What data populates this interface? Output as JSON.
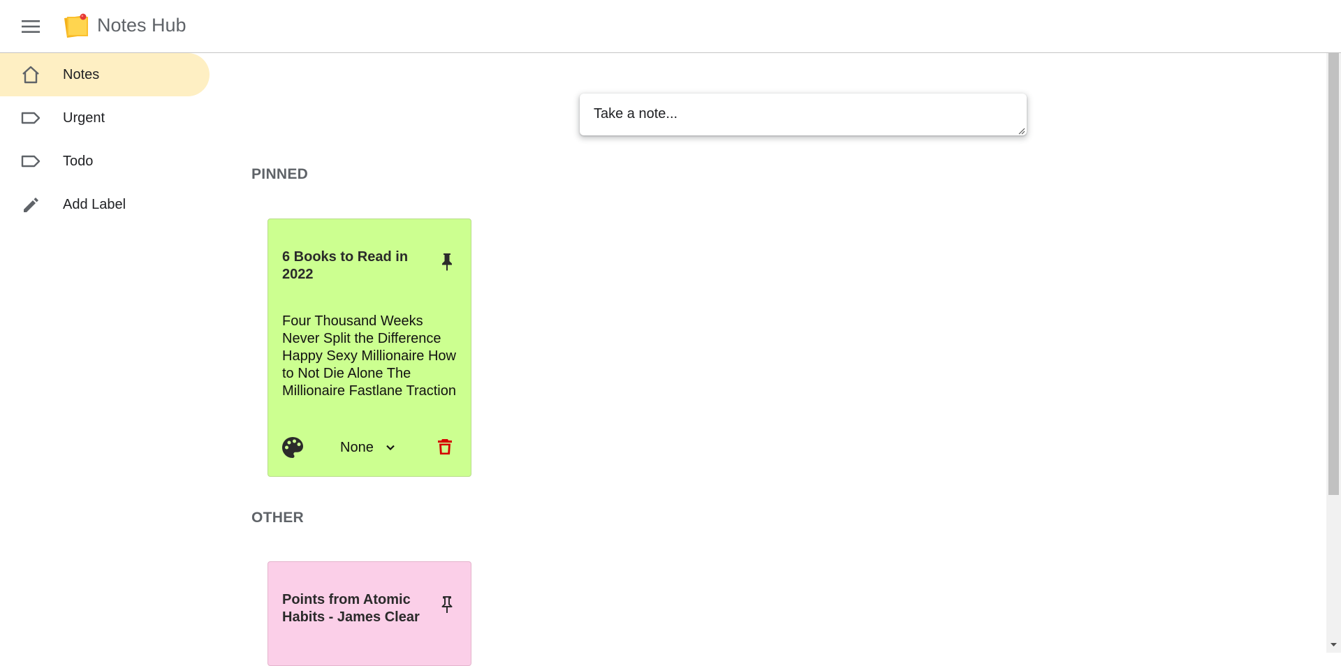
{
  "app": {
    "title": "Notes Hub",
    "logo_icon": "notes-logo-icon",
    "menu_icon": "hamburger-menu-icon"
  },
  "sidebar": {
    "items": [
      {
        "label": "Notes",
        "icon": "home-icon",
        "active": true
      },
      {
        "label": "Urgent",
        "icon": "label-icon",
        "active": false
      },
      {
        "label": "Todo",
        "icon": "label-icon",
        "active": false
      },
      {
        "label": "Add Label",
        "icon": "pencil-icon",
        "active": false
      }
    ],
    "active_color": "#feefc3"
  },
  "composer": {
    "placeholder": "Take a note..."
  },
  "sections": {
    "pinned": "PINNED",
    "other": "OTHER"
  },
  "notes": {
    "pinned": [
      {
        "title": "6 Books to Read in 2022",
        "body": "Four Thousand Weeks Never Split the Difference Happy Sexy Millionaire How to Not Die Alone The Millionaire Fastlane Traction",
        "label": "None",
        "color": "#ccff90",
        "pinned": true
      }
    ],
    "other": [
      {
        "title": "Points from Atomic Habits - James Clear",
        "color": "#fbcfe8",
        "pinned": false
      }
    ]
  },
  "colors": {
    "delete": "#d50000",
    "section_title": "#5f6368"
  }
}
